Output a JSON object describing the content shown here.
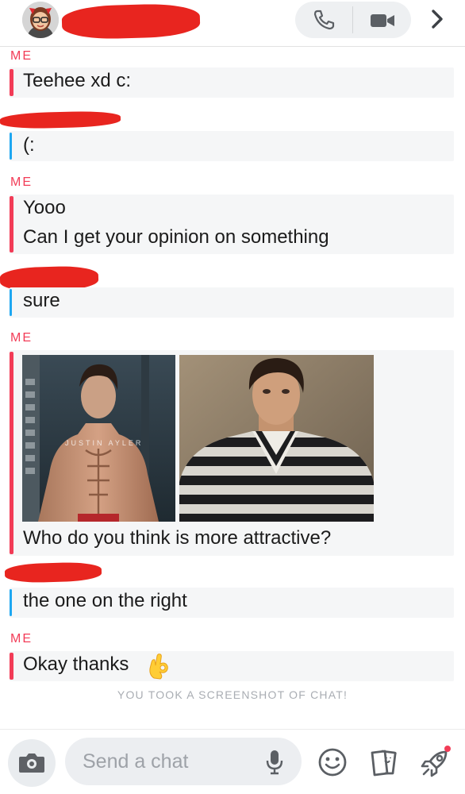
{
  "header": {
    "call_label": "Voice call",
    "video_label": "Video call"
  },
  "messages": [
    {
      "sender": "ME",
      "mine": true,
      "lines": [
        "Teehee xd c:"
      ]
    },
    {
      "sender": "",
      "mine": false,
      "lines": [
        "(:"
      ]
    },
    {
      "sender": "ME",
      "mine": true,
      "lines": [
        "Yooo",
        "Can I get your opinion on something"
      ]
    },
    {
      "sender": "",
      "mine": false,
      "lines": [
        "sure"
      ]
    },
    {
      "sender": "ME",
      "mine": true,
      "lines": [
        "Who do you think is more attractive?"
      ],
      "photo_watermark": "JUSTIN AYLER"
    },
    {
      "sender": "",
      "mine": false,
      "lines": [
        "the one on the right"
      ]
    },
    {
      "sender": "ME",
      "mine": true,
      "lines": [
        "Okay thanks"
      ],
      "emoji": "ok-hand-emoji"
    }
  ],
  "notice": "YOU TOOK A SCREENSHOT OF CHAT!",
  "composer": {
    "placeholder": "Send a chat"
  },
  "colors": {
    "me_accent": "#f23c57",
    "them_accent": "#1ea7f1",
    "redaction": "#e8251f",
    "bubble_bg": "#f5f6f7"
  },
  "icons": [
    "phone-icon",
    "video-icon",
    "chevron-right-icon",
    "camera-icon",
    "microphone-icon",
    "smiley-icon",
    "stickers-icon",
    "rocket-icon"
  ]
}
